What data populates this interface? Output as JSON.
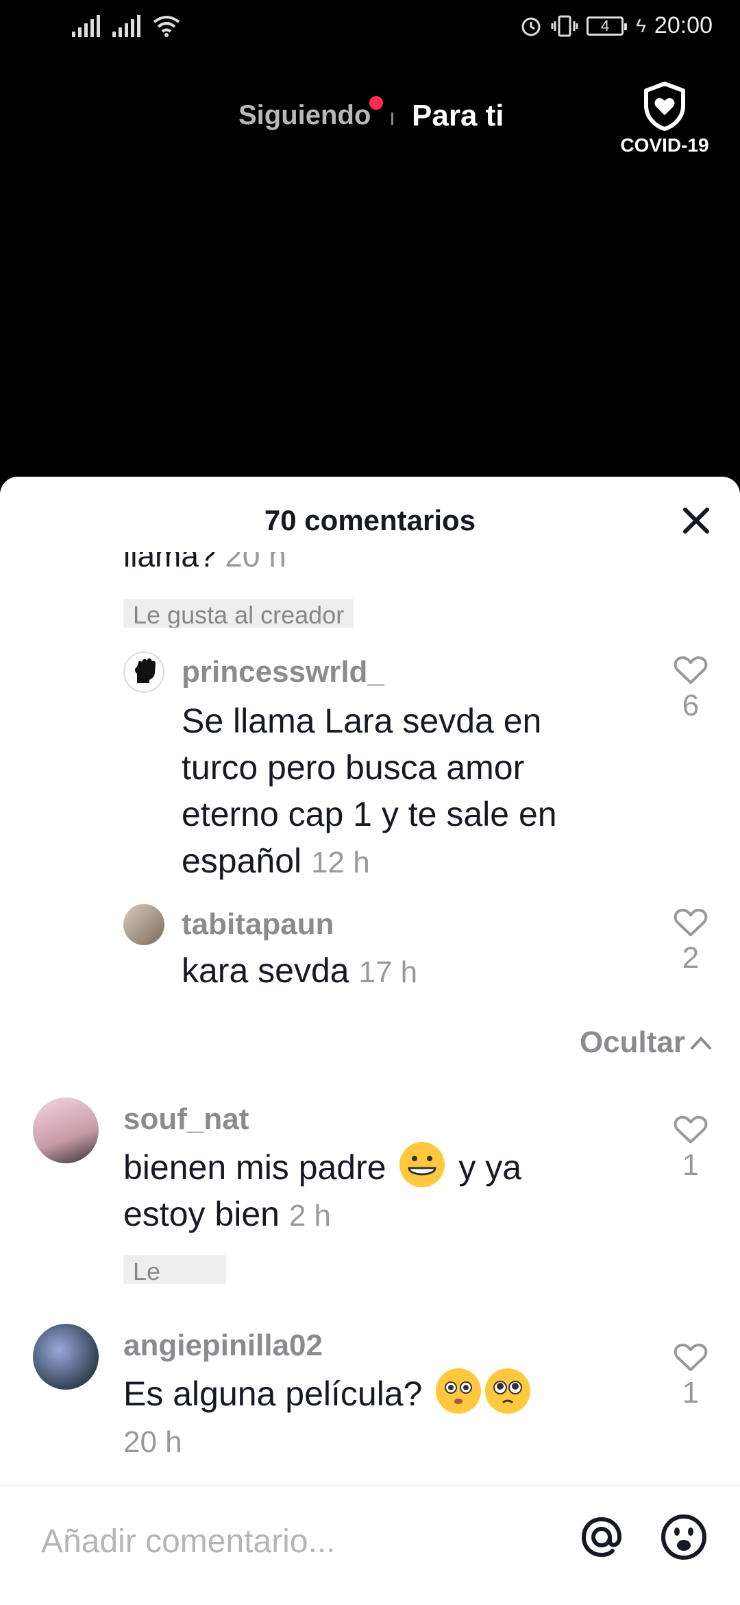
{
  "status_bar": {
    "battery_level": "4",
    "time": "20:00"
  },
  "top_nav": {
    "following_label": "Siguiendo",
    "for_you_label": "Para ti",
    "covid_label": "COVID-19"
  },
  "comments_sheet": {
    "title": "70 comentarios",
    "partial_comment": {
      "text": "llama?",
      "time": "20 h"
    },
    "liked_by_creator_label": "Le gusta al creador",
    "hide_label": "Ocultar",
    "comments": [
      {
        "username": "princesswrld_",
        "text": "Se llama Lara sevda en turco pero busca amor eterno cap 1 y te sale en español",
        "time": "12 h",
        "likes": "6"
      },
      {
        "username": "tabitapaun",
        "text": "kara sevda",
        "time": "17 h",
        "likes": "2"
      },
      {
        "username": "souf_nat",
        "text": "bienen mis padre",
        "text_after": "y ya estoy bien",
        "time": "2 h",
        "likes": "1"
      },
      {
        "username": "angiepinilla02",
        "text": "Es alguna película?",
        "time": "20 h",
        "likes": "1"
      }
    ]
  },
  "input_bar": {
    "placeholder": "Añadir comentario..."
  },
  "colors": {
    "accent": "#fe2c55",
    "text_primary": "#161823",
    "text_secondary": "#8a8b91"
  }
}
